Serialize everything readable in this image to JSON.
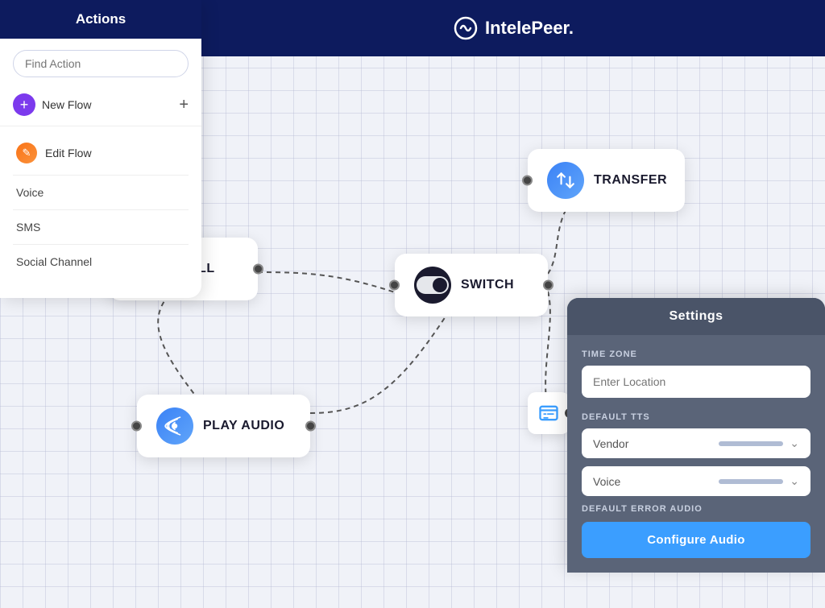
{
  "sidebar": {
    "title": "Actions",
    "search_placeholder": "Find Action",
    "new_flow_label": "New Flow",
    "new_flow_plus": "+",
    "menu_items": [
      {
        "id": "edit-flow",
        "label": "Edit Flow",
        "icon": "edit-icon"
      },
      {
        "id": "voice",
        "label": "Voice"
      },
      {
        "id": "sms",
        "label": "SMS"
      },
      {
        "id": "social-channel",
        "label": "Social Channel"
      }
    ]
  },
  "header": {
    "logo_text": "IntelePeer."
  },
  "nodes": {
    "icall": {
      "label": "ICALL"
    },
    "play_audio": {
      "label": "PLAY AUDIO"
    },
    "switch": {
      "label": "SWITCH"
    },
    "transfer": {
      "label": "TRANSFER"
    }
  },
  "settings": {
    "title": "Settings",
    "timezone_label": "TIME ZONE",
    "timezone_placeholder": "Enter Location",
    "tts_label": "DEFAULT TTS",
    "vendor_label": "Vendor",
    "voice_label": "Voice",
    "error_audio_label": "DEFAULT ERROR AUDIO",
    "configure_button": "Configure Audio"
  }
}
